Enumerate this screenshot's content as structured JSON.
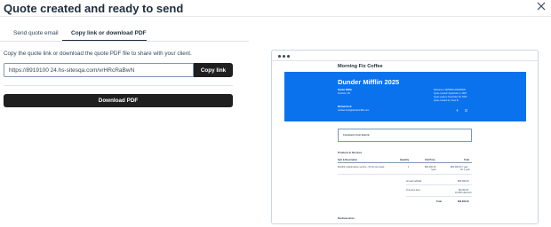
{
  "dialog": {
    "title": "Quote created and ready to send",
    "close_icon": "close-icon"
  },
  "tabs": [
    {
      "label": "Send quote email",
      "active": false
    },
    {
      "label": "Copy link or download PDF",
      "active": true
    }
  ],
  "copy_link": {
    "description": "Copy the quote link or download the quote PDF file to share with your client.",
    "link_value": "https://8919100 24.hs-sitesqa.com/vrHRcRaBwN",
    "copy_label": "Copy link",
    "download_label": "Download PDF"
  },
  "preview": {
    "company": "Morning Fix Coffee",
    "quote_title": "Dunder Mifflin 2025",
    "to": {
      "name": "Dunder Mifflin",
      "location": "Scranton, PA"
    },
    "details": {
      "reference": "Reference: 20250801-000000000",
      "created": "Quote created: September 1, 2025",
      "expires": "Quote expires: November 30, 2025",
      "created_by": "Quote created by: Sean B."
    },
    "contact": {
      "name": "Michael Scott",
      "email": "michael.scott@dundermifflin.com"
    },
    "comments_label": "Comments from Sean B.",
    "products_heading": "Products & Services",
    "columns": [
      "Item & Description",
      "Quantity",
      "Unit Price",
      "Total"
    ],
    "line_item": {
      "name": "Monthly maintenance service - 60 hrs per week",
      "quantity": "1",
      "unit_price": "$00,000.00",
      "unit_price_sub": "/year",
      "total": "$00,000.00 / year",
      "total_sub": "for 1 year"
    },
    "annual_subtotal_label": "Annual subtotal",
    "annual_subtotal": "$00,000.00",
    "one_time_label": "One-time fees",
    "one_time_values": [
      "$0,000.00",
      "10.00% discount"
    ],
    "total_label": "Total",
    "total": "$00,000.00",
    "purchase_terms": "Purchase terms"
  }
}
